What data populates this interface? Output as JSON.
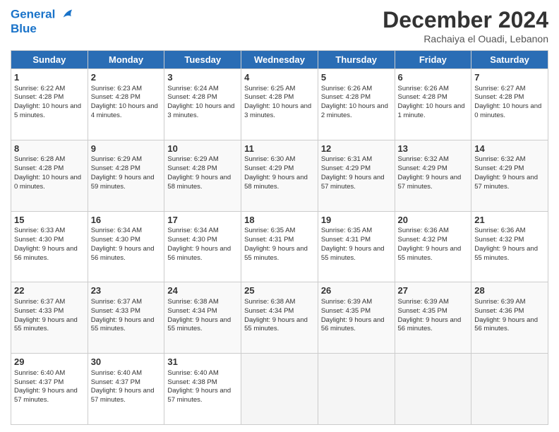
{
  "header": {
    "logo_line1": "General",
    "logo_line2": "Blue",
    "month_title": "December 2024",
    "location": "Rachaiya el Ouadi, Lebanon"
  },
  "days_of_week": [
    "Sunday",
    "Monday",
    "Tuesday",
    "Wednesday",
    "Thursday",
    "Friday",
    "Saturday"
  ],
  "weeks": [
    [
      {
        "day": 1,
        "sunrise": "6:22 AM",
        "sunset": "4:28 PM",
        "daylight": "10 hours and 5 minutes."
      },
      {
        "day": 2,
        "sunrise": "6:23 AM",
        "sunset": "4:28 PM",
        "daylight": "10 hours and 4 minutes."
      },
      {
        "day": 3,
        "sunrise": "6:24 AM",
        "sunset": "4:28 PM",
        "daylight": "10 hours and 3 minutes."
      },
      {
        "day": 4,
        "sunrise": "6:25 AM",
        "sunset": "4:28 PM",
        "daylight": "10 hours and 3 minutes."
      },
      {
        "day": 5,
        "sunrise": "6:26 AM",
        "sunset": "4:28 PM",
        "daylight": "10 hours and 2 minutes."
      },
      {
        "day": 6,
        "sunrise": "6:26 AM",
        "sunset": "4:28 PM",
        "daylight": "10 hours and 1 minute."
      },
      {
        "day": 7,
        "sunrise": "6:27 AM",
        "sunset": "4:28 PM",
        "daylight": "10 hours and 0 minutes."
      }
    ],
    [
      {
        "day": 8,
        "sunrise": "6:28 AM",
        "sunset": "4:28 PM",
        "daylight": "10 hours and 0 minutes."
      },
      {
        "day": 9,
        "sunrise": "6:29 AM",
        "sunset": "4:28 PM",
        "daylight": "9 hours and 59 minutes."
      },
      {
        "day": 10,
        "sunrise": "6:29 AM",
        "sunset": "4:28 PM",
        "daylight": "9 hours and 58 minutes."
      },
      {
        "day": 11,
        "sunrise": "6:30 AM",
        "sunset": "4:29 PM",
        "daylight": "9 hours and 58 minutes."
      },
      {
        "day": 12,
        "sunrise": "6:31 AM",
        "sunset": "4:29 PM",
        "daylight": "9 hours and 57 minutes."
      },
      {
        "day": 13,
        "sunrise": "6:32 AM",
        "sunset": "4:29 PM",
        "daylight": "9 hours and 57 minutes."
      },
      {
        "day": 14,
        "sunrise": "6:32 AM",
        "sunset": "4:29 PM",
        "daylight": "9 hours and 57 minutes."
      }
    ],
    [
      {
        "day": 15,
        "sunrise": "6:33 AM",
        "sunset": "4:30 PM",
        "daylight": "9 hours and 56 minutes."
      },
      {
        "day": 16,
        "sunrise": "6:34 AM",
        "sunset": "4:30 PM",
        "daylight": "9 hours and 56 minutes."
      },
      {
        "day": 17,
        "sunrise": "6:34 AM",
        "sunset": "4:30 PM",
        "daylight": "9 hours and 56 minutes."
      },
      {
        "day": 18,
        "sunrise": "6:35 AM",
        "sunset": "4:31 PM",
        "daylight": "9 hours and 55 minutes."
      },
      {
        "day": 19,
        "sunrise": "6:35 AM",
        "sunset": "4:31 PM",
        "daylight": "9 hours and 55 minutes."
      },
      {
        "day": 20,
        "sunrise": "6:36 AM",
        "sunset": "4:32 PM",
        "daylight": "9 hours and 55 minutes."
      },
      {
        "day": 21,
        "sunrise": "6:36 AM",
        "sunset": "4:32 PM",
        "daylight": "9 hours and 55 minutes."
      }
    ],
    [
      {
        "day": 22,
        "sunrise": "6:37 AM",
        "sunset": "4:33 PM",
        "daylight": "9 hours and 55 minutes."
      },
      {
        "day": 23,
        "sunrise": "6:37 AM",
        "sunset": "4:33 PM",
        "daylight": "9 hours and 55 minutes."
      },
      {
        "day": 24,
        "sunrise": "6:38 AM",
        "sunset": "4:34 PM",
        "daylight": "9 hours and 55 minutes."
      },
      {
        "day": 25,
        "sunrise": "6:38 AM",
        "sunset": "4:34 PM",
        "daylight": "9 hours and 55 minutes."
      },
      {
        "day": 26,
        "sunrise": "6:39 AM",
        "sunset": "4:35 PM",
        "daylight": "9 hours and 56 minutes."
      },
      {
        "day": 27,
        "sunrise": "6:39 AM",
        "sunset": "4:35 PM",
        "daylight": "9 hours and 56 minutes."
      },
      {
        "day": 28,
        "sunrise": "6:39 AM",
        "sunset": "4:36 PM",
        "daylight": "9 hours and 56 minutes."
      }
    ],
    [
      {
        "day": 29,
        "sunrise": "6:40 AM",
        "sunset": "4:37 PM",
        "daylight": "9 hours and 57 minutes."
      },
      {
        "day": 30,
        "sunrise": "6:40 AM",
        "sunset": "4:37 PM",
        "daylight": "9 hours and 57 minutes."
      },
      {
        "day": 31,
        "sunrise": "6:40 AM",
        "sunset": "4:38 PM",
        "daylight": "9 hours and 57 minutes."
      },
      null,
      null,
      null,
      null
    ]
  ]
}
